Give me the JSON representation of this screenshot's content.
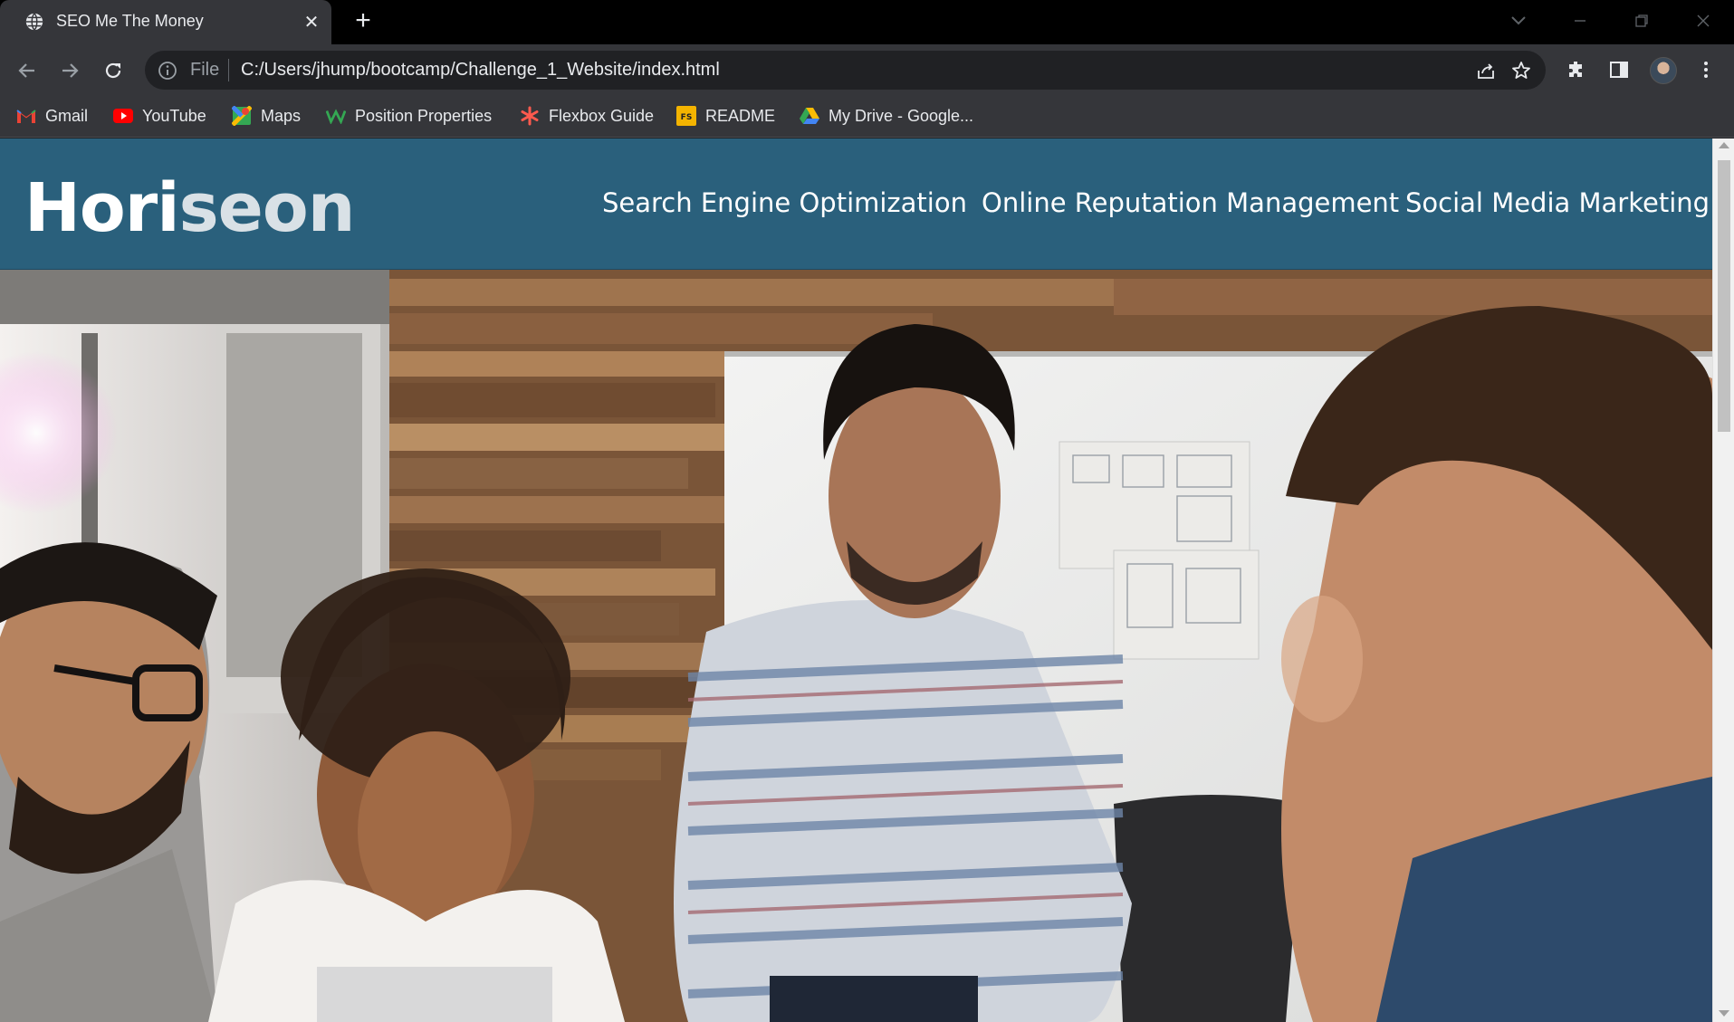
{
  "browser": {
    "tab": {
      "title": "SEO Me The Money",
      "close": "✕"
    },
    "new_tab": "+",
    "omnibox": {
      "scheme_label": "File",
      "url": "C:/Users/jhump/bootcamp/Challenge_1_Website/index.html"
    },
    "bookmarks": [
      {
        "label": "Gmail",
        "icon": "gmail-icon"
      },
      {
        "label": "YouTube",
        "icon": "youtube-icon"
      },
      {
        "label": "Maps",
        "icon": "maps-icon"
      },
      {
        "label": "Position Properties",
        "icon": "w-icon"
      },
      {
        "label": "Flexbox Guide",
        "icon": "asterisk-icon"
      },
      {
        "label": "README",
        "icon": "fs-icon"
      },
      {
        "label": "My Drive - Google...",
        "icon": "google-drive-icon"
      }
    ]
  },
  "site": {
    "logo": {
      "main": "Hori",
      "accent": "seon"
    },
    "nav": [
      {
        "label": "Search Engine Optimization"
      },
      {
        "label": "Online Reputation Management"
      },
      {
        "label": "Social Media Marketing"
      }
    ],
    "colors": {
      "header_bg": "#2a607c",
      "logo_accent": "#d9e1e6"
    }
  }
}
